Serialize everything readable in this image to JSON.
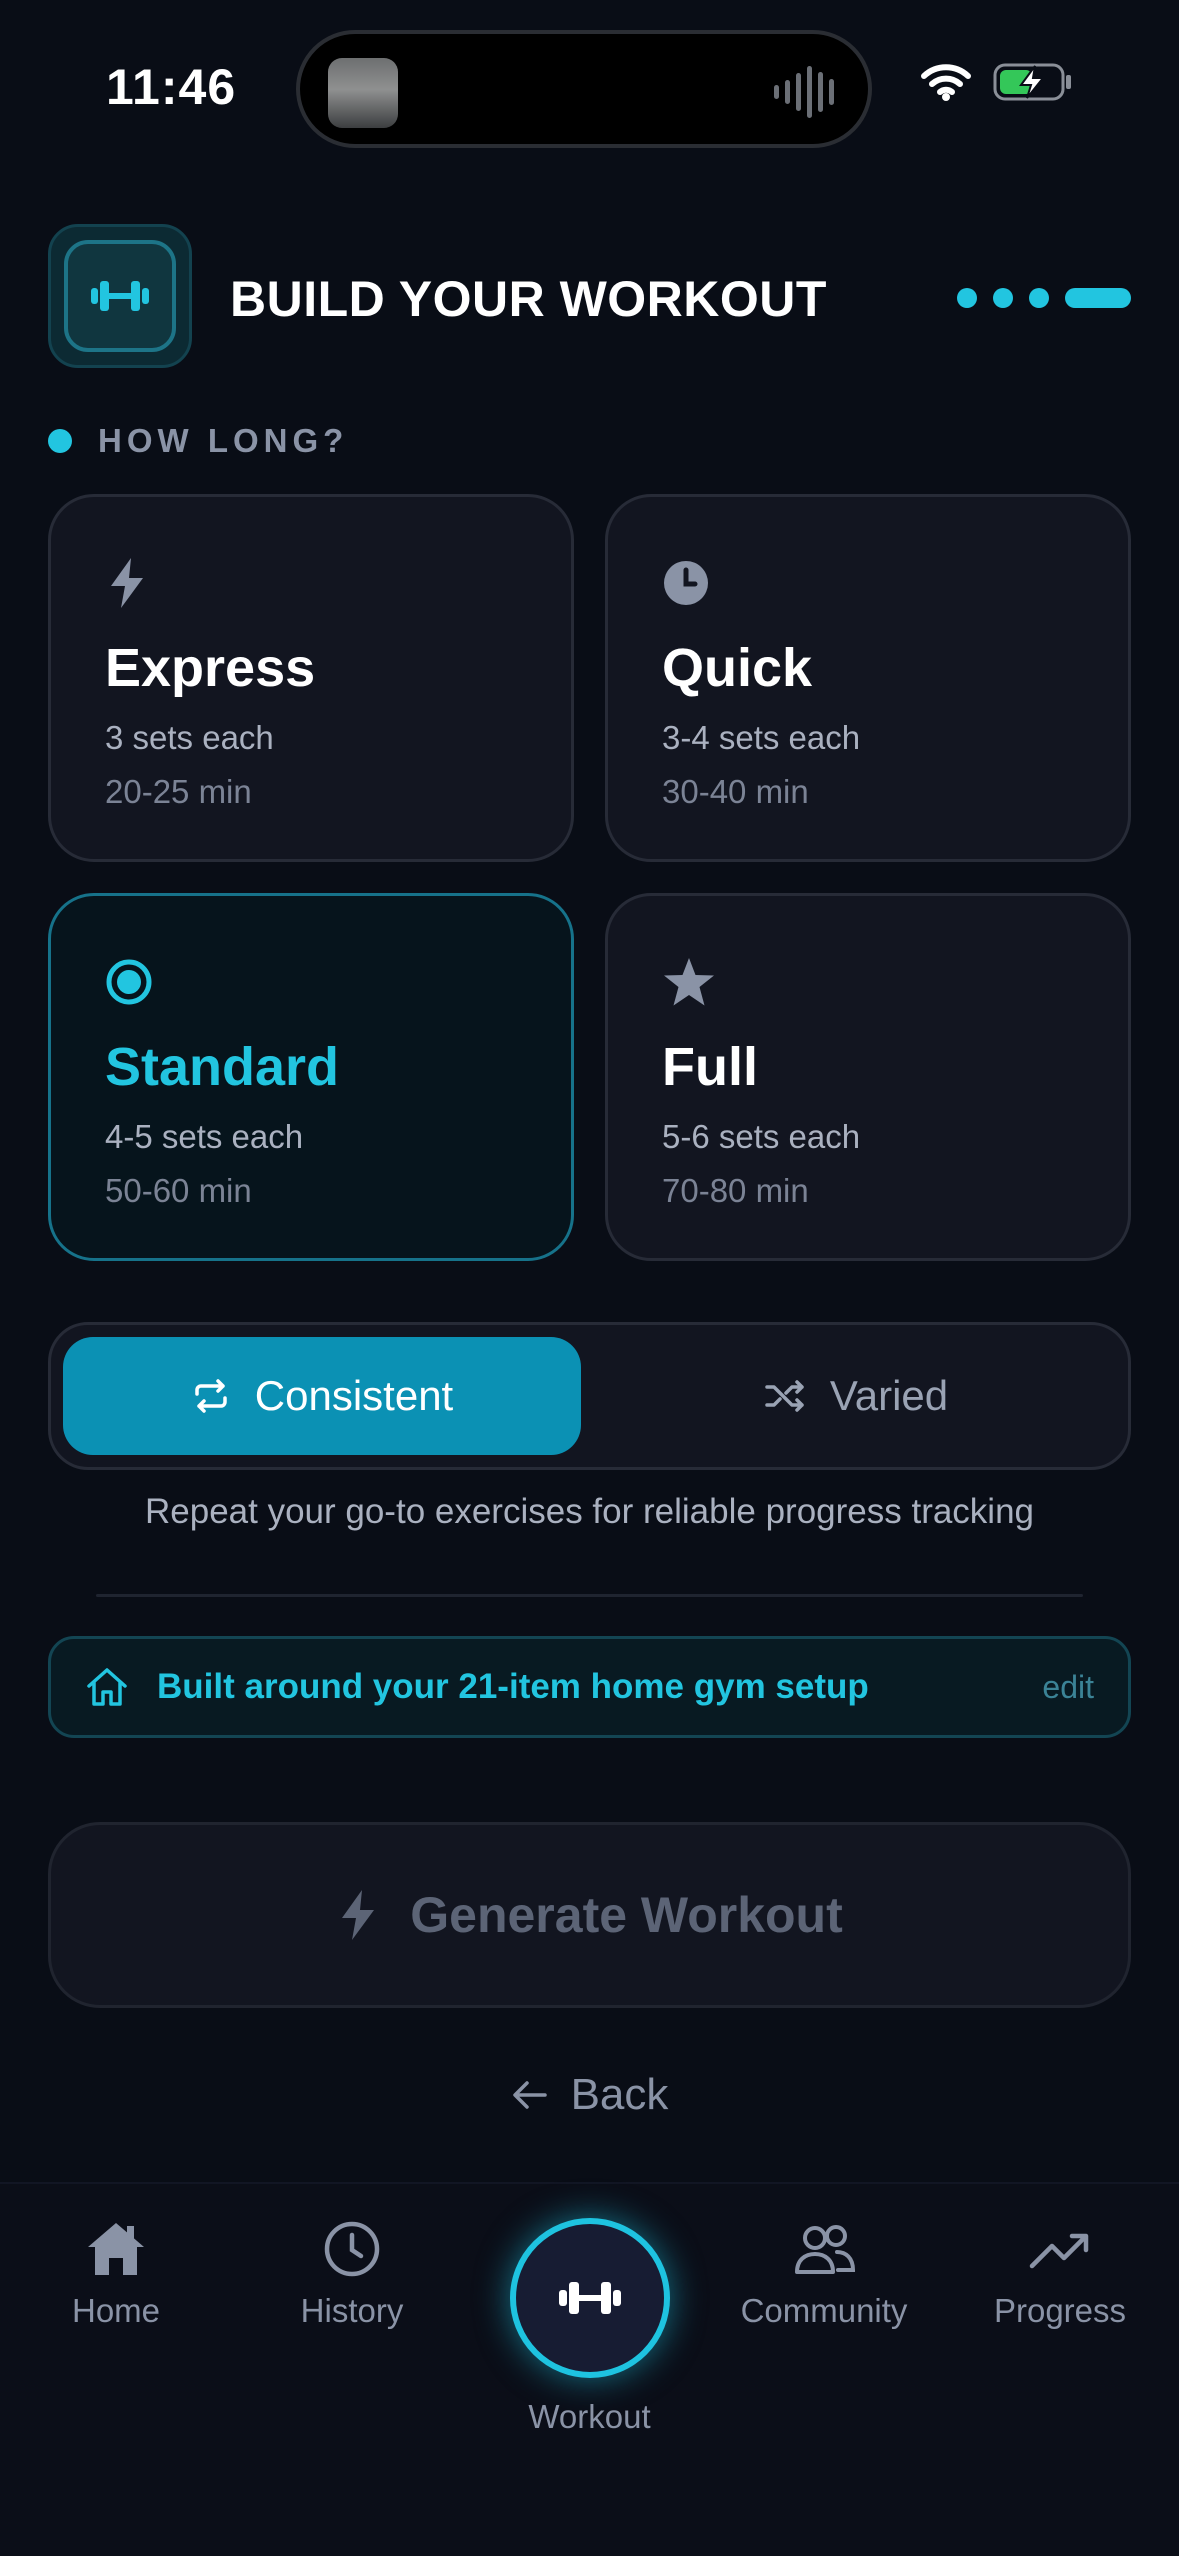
{
  "status_bar": {
    "time": "11:46"
  },
  "header": {
    "title": "BUILD YOUR WORKOUT"
  },
  "duration": {
    "label": "HOW LONG?",
    "options": [
      {
        "name": "Express",
        "sets": "3 sets each",
        "time": "20-25 min",
        "icon": "bolt-icon"
      },
      {
        "name": "Quick",
        "sets": "3-4 sets each",
        "time": "30-40 min",
        "icon": "clock-icon"
      },
      {
        "name": "Standard",
        "sets": "4-5 sets each",
        "time": "50-60 min",
        "icon": "radio-target-icon"
      },
      {
        "name": "Full",
        "sets": "5-6 sets each",
        "time": "70-80 min",
        "icon": "star-icon"
      }
    ],
    "selected": "Standard"
  },
  "mode_toggle": {
    "options": [
      "Consistent",
      "Varied"
    ],
    "selected": "Consistent",
    "description": "Repeat your go-to exercises for reliable progress tracking"
  },
  "gym_banner": {
    "text": "Built around your 21-item home gym setup",
    "edit": "edit"
  },
  "generate_button": {
    "label": "Generate Workout"
  },
  "back_button": {
    "label": "Back"
  },
  "tab_bar": {
    "items": [
      {
        "label": "Home",
        "icon": "home-icon"
      },
      {
        "label": "History",
        "icon": "clock-icon"
      },
      {
        "label": "Workout",
        "icon": "dumbbell-icon"
      },
      {
        "label": "Community",
        "icon": "people-icon"
      },
      {
        "label": "Progress",
        "icon": "trend-icon"
      }
    ],
    "active": "Workout"
  },
  "colors": {
    "background": "#090d16",
    "accent": "#22c5e0",
    "accent_button": "#0b91b4",
    "card": "#121520",
    "muted_text": "#8a93a6"
  }
}
